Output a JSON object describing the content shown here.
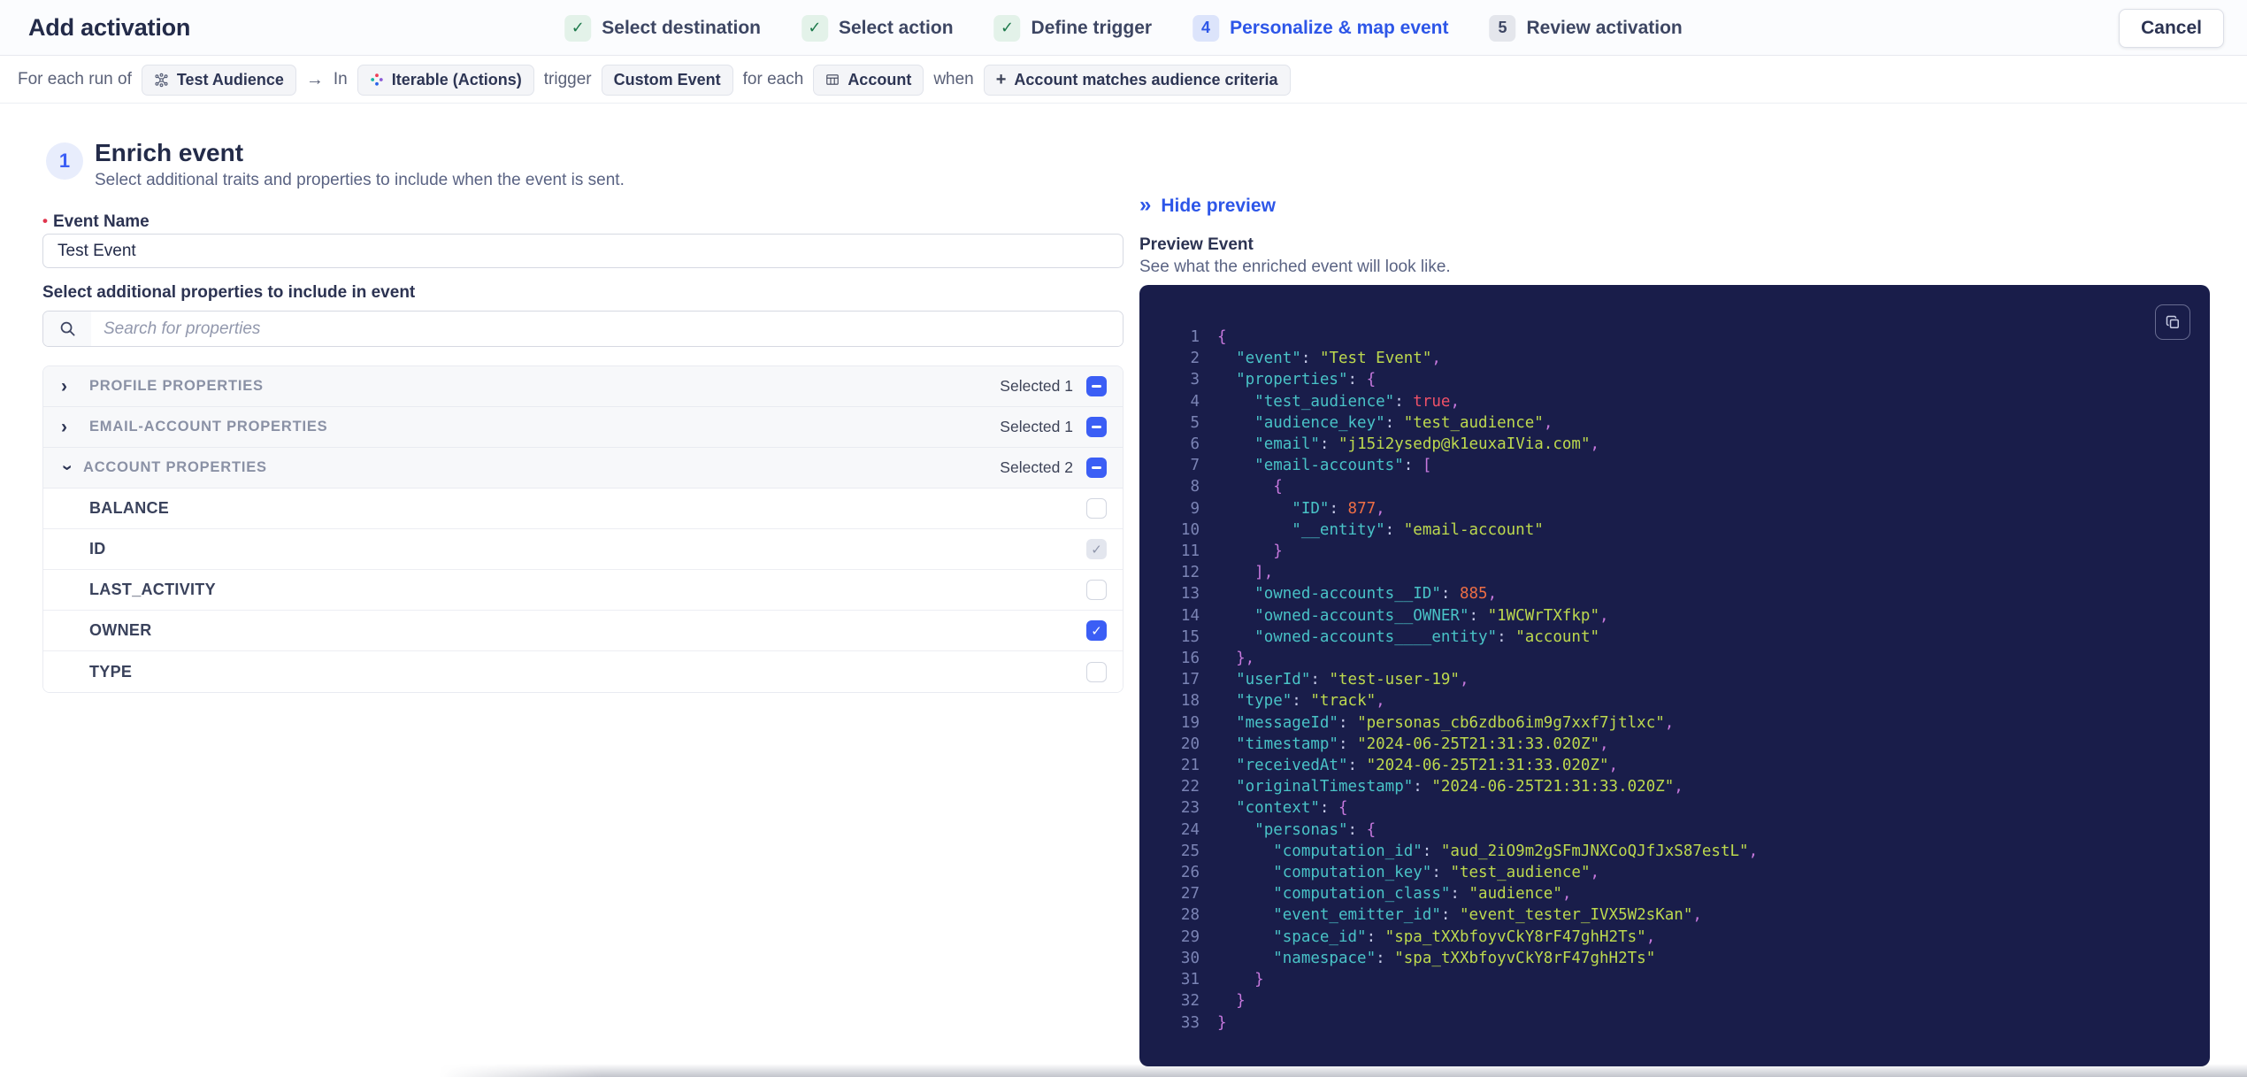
{
  "colors": {
    "accent_blue": "#2d56e8",
    "checkbox_blue": "#3b5ef5",
    "step_done_green": "#1e7a4c",
    "step_done_bg": "#e3f2e9",
    "active_step_bg": "#dce4fb",
    "required_red": "#e0364e",
    "code_bg": "#191d4a",
    "code_line_number": "#7b84b5",
    "code_key": "#49c3c7",
    "code_string": "#bdd94e",
    "code_number": "#ed6e45",
    "code_boolean": "#ee5168",
    "code_punctuation": "#c678dd"
  },
  "icons": {
    "check": "✓",
    "chevron": "›",
    "double_chevron": "»",
    "arrow": "→",
    "plus": "+"
  },
  "header": {
    "title": "Add activation",
    "cancel_label": "Cancel",
    "steps": [
      {
        "label": "Select destination",
        "status": "done"
      },
      {
        "label": "Select action",
        "status": "done"
      },
      {
        "label": "Define trigger",
        "status": "done"
      },
      {
        "num": "4",
        "label": "Personalize & map event",
        "status": "active"
      },
      {
        "num": "5",
        "label": "Review activation",
        "status": "upcoming"
      }
    ]
  },
  "trigger_bar": {
    "parts": [
      {
        "type": "text",
        "text": "For each run of"
      },
      {
        "type": "chip",
        "icon": "audience-icon",
        "label": "Test Audience"
      },
      {
        "type": "arrow",
        "text": "→"
      },
      {
        "type": "text",
        "text": "In"
      },
      {
        "type": "chip",
        "icon": "iterable-icon",
        "label": "Iterable (Actions)"
      },
      {
        "type": "text",
        "text": "trigger"
      },
      {
        "type": "chip",
        "label": "Custom Event"
      },
      {
        "type": "text",
        "text": "for each"
      },
      {
        "type": "chip",
        "icon": "table-icon",
        "label": "Account"
      },
      {
        "type": "text",
        "text": "when"
      },
      {
        "type": "chip",
        "icon": "plus-icon",
        "label": "Account matches audience criteria"
      }
    ]
  },
  "enrich": {
    "step_number": "1",
    "title": "Enrich event",
    "subtitle": "Select additional traits and properties to include when the event is sent.",
    "required_marker": "•",
    "event_name_label": "Event Name",
    "event_name_value": "Test Event",
    "properties_label": "Select additional properties to include in event",
    "search_placeholder": "Search for properties",
    "groups": [
      {
        "label": "PROFILE PROPERTIES",
        "selected_label": "Selected 1",
        "expanded": false,
        "checkbox": "indeterminate",
        "items": []
      },
      {
        "label": "EMAIL-ACCOUNT PROPERTIES",
        "selected_label": "Selected 1",
        "expanded": false,
        "checkbox": "indeterminate",
        "items": []
      },
      {
        "label": "ACCOUNT PROPERTIES",
        "selected_label": "Selected 2",
        "expanded": true,
        "checkbox": "indeterminate",
        "items": [
          {
            "label": "BALANCE",
            "state": "unchecked"
          },
          {
            "label": "ID",
            "state": "checked-disabled"
          },
          {
            "label": "LAST_ACTIVITY",
            "state": "unchecked"
          },
          {
            "label": "OWNER",
            "state": "checked"
          },
          {
            "label": "TYPE",
            "state": "unchecked"
          }
        ]
      }
    ]
  },
  "preview": {
    "hide_label": "Hide preview",
    "title": "Preview Event",
    "subtitle": "See what the enriched event will look like.",
    "code_lines": [
      "{",
      "  \"event\": \"Test Event\",",
      "  \"properties\": {",
      "    \"test_audience\": true,",
      "    \"audience_key\": \"test_audience\",",
      "    \"email\": \"j15i2ysedp@k1euxaIVia.com\",",
      "    \"email-accounts\": [",
      "      {",
      "        \"ID\": 877,",
      "        \"__entity\": \"email-account\"",
      "      }",
      "    ],",
      "    \"owned-accounts__ID\": 885,",
      "    \"owned-accounts__OWNER\": \"1WCWrTXfkp\",",
      "    \"owned-accounts____entity\": \"account\"",
      "  },",
      "  \"userId\": \"test-user-19\",",
      "  \"type\": \"track\",",
      "  \"messageId\": \"personas_cb6zdbo6im9g7xxf7jtlxc\",",
      "  \"timestamp\": \"2024-06-25T21:31:33.020Z\",",
      "  \"receivedAt\": \"2024-06-25T21:31:33.020Z\",",
      "  \"originalTimestamp\": \"2024-06-25T21:31:33.020Z\",",
      "  \"context\": {",
      "    \"personas\": {",
      "      \"computation_id\": \"aud_2iO9m2gSFmJNXCoQJfJxS87estL\",",
      "      \"computation_key\": \"test_audience\",",
      "      \"computation_class\": \"audience\",",
      "      \"event_emitter_id\": \"event_tester_IVX5W2sKan\",",
      "      \"space_id\": \"spa_tXXbfoyvCkY8rF47ghH2Ts\",",
      "      \"namespace\": \"spa_tXXbfoyvCkY8rF47ghH2Ts\"",
      "    }",
      "  }",
      "}"
    ]
  }
}
